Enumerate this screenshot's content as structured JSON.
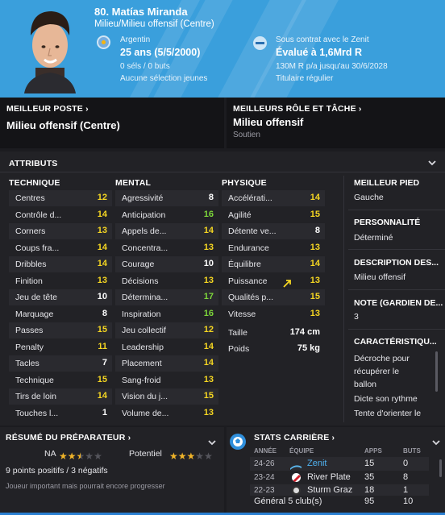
{
  "header": {
    "title": "80. Matías Miranda",
    "position": "Milieu/Milieu offensif (Centre)",
    "country": "Argentin",
    "age": "25 ans (5/5/2000)",
    "caps": "0 séls / 0 buts",
    "youth": "Aucune sélection jeunes",
    "contract": "Sous contrat avec le Zenit",
    "value": "Évalué à 1,6Mrd R",
    "wage": "130M R p/a jusqu'au 30/6/2028",
    "status": "Titulaire régulier"
  },
  "best_position": {
    "label": "MEILLEUR POSTE ›",
    "value": "Milieu offensif (Centre)"
  },
  "best_role": {
    "label": "MEILLEURS RÔLE ET TÂCHE ›",
    "value": "Milieu offensif",
    "duty": "Soutien"
  },
  "attributes": {
    "title": "ATTRIBUTS",
    "technical_title": "TECHNIQUE",
    "mental_title": "MENTAL",
    "physical_title": "PHYSIQUE",
    "technical": [
      {
        "name": "Centres",
        "value": "12"
      },
      {
        "name": "Contrôle d...",
        "value": "14"
      },
      {
        "name": "Corners",
        "value": "13"
      },
      {
        "name": "Coups fra...",
        "value": "14"
      },
      {
        "name": "Dribbles",
        "value": "14"
      },
      {
        "name": "Finition",
        "value": "13"
      },
      {
        "name": "Jeu de tête",
        "value": "10"
      },
      {
        "name": "Marquage",
        "value": "8"
      },
      {
        "name": "Passes",
        "value": "15"
      },
      {
        "name": "Penalty",
        "value": "11"
      },
      {
        "name": "Tacles",
        "value": "7"
      },
      {
        "name": "Technique",
        "value": "15"
      },
      {
        "name": "Tirs de loin",
        "value": "14"
      },
      {
        "name": "Touches l...",
        "value": "1"
      }
    ],
    "mental": [
      {
        "name": "Agressivité",
        "value": "8"
      },
      {
        "name": "Anticipation",
        "value": "16"
      },
      {
        "name": "Appels de...",
        "value": "14"
      },
      {
        "name": "Concentra...",
        "value": "13"
      },
      {
        "name": "Courage",
        "value": "10"
      },
      {
        "name": "Décisions",
        "value": "13"
      },
      {
        "name": "Détermina...",
        "value": "17"
      },
      {
        "name": "Inspiration",
        "value": "16"
      },
      {
        "name": "Jeu collectif",
        "value": "12"
      },
      {
        "name": "Leadership",
        "value": "14"
      },
      {
        "name": "Placement",
        "value": "14"
      },
      {
        "name": "Sang-froid",
        "value": "13"
      },
      {
        "name": "Vision du j...",
        "value": "15"
      },
      {
        "name": "Volume de...",
        "value": "13"
      }
    ],
    "physical": [
      {
        "name": "Accélérati...",
        "value": "14"
      },
      {
        "name": "Agilité",
        "value": "15"
      },
      {
        "name": "Détente ve...",
        "value": "8"
      },
      {
        "name": "Endurance",
        "value": "13"
      },
      {
        "name": "Équilibre",
        "value": "14"
      },
      {
        "name": "Puissance",
        "value": "13"
      },
      {
        "name": "Qualités p...",
        "value": "15"
      },
      {
        "name": "Vitesse",
        "value": "13"
      }
    ],
    "height_label": "Taille",
    "height": "174 cm",
    "weight_label": "Poids",
    "weight": "75 kg"
  },
  "side": {
    "best_foot_title": "MEILLEUR PIED",
    "best_foot": "Gauche",
    "personality_title": "PERSONNALITÉ",
    "personality": "Déterminé",
    "description_title": "DESCRIPTION DES...",
    "description": "Milieu offensif",
    "gk_title": "NOTE (GARDIEN DE...",
    "gk": "3",
    "traits_title": "CARACTÉRISTIQU...",
    "traits": [
      "Décroche pour",
      "récupérer le",
      "ballon",
      "Dicte son rythme",
      "Tente d'orienter le"
    ]
  },
  "coach": {
    "title": "RÉSUMÉ DU PRÉPARATEUR ›",
    "na_label": "NA",
    "na_stars": 2.5,
    "potential_label": "Potentiel",
    "potential_stars": 3,
    "summary": "9 points positifs / 3 négatifs",
    "comment": "Joueur important mais pourrait encore progresser"
  },
  "career": {
    "title": "STATS CARRIÈRE ›",
    "headers": [
      "ANNÉE",
      "ÉQUIPE",
      "APPS",
      "BUTS"
    ],
    "rows": [
      {
        "year": "24-26",
        "team": "Zenit",
        "apps": "15",
        "goals": "0"
      },
      {
        "year": "23-24",
        "team": "River Plate",
        "apps": "35",
        "goals": "8"
      },
      {
        "year": "22-23",
        "team": "Sturm Graz",
        "apps": "18",
        "goals": "1"
      }
    ],
    "total_label": "Général 5 club(s)",
    "total_apps": "95",
    "total_goals": "10"
  },
  "colors": {
    "header_bg": "#3a9fdc",
    "value_yellow": "#f5d622",
    "value_green": "#7dd63a",
    "value_white": "#ffffff",
    "star": "#f0b429",
    "accent_blue": "#2a7fd1"
  }
}
